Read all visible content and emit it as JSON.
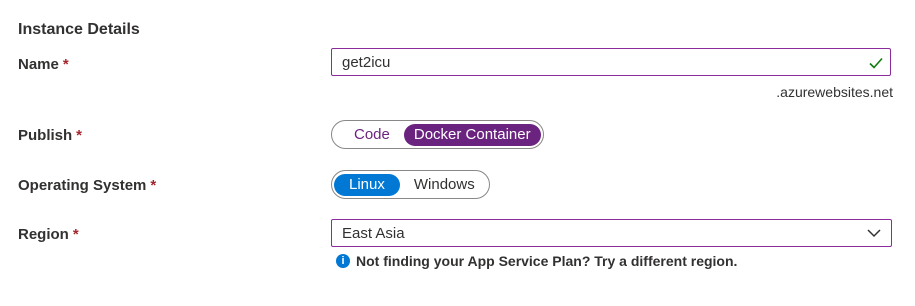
{
  "section": {
    "title": "Instance Details"
  },
  "fields": {
    "name": {
      "label": "Name",
      "required": "*",
      "value": "get2icu",
      "suffix": ".azurewebsites.net"
    },
    "publish": {
      "label": "Publish",
      "required": "*",
      "options": [
        "Code",
        "Docker Container"
      ],
      "selected": "Docker Container"
    },
    "os": {
      "label": "Operating System",
      "required": "*",
      "options": [
        "Linux",
        "Windows"
      ],
      "selected": "Linux"
    },
    "region": {
      "label": "Region",
      "required": "*",
      "value": "East Asia",
      "info": "Not finding your App Service Plan? Try a different region."
    }
  },
  "icons": {
    "valid": "checkmark-icon",
    "dropdown": "chevron-down-icon",
    "info": "info-icon"
  },
  "colors": {
    "accent_purple": "#6b2380",
    "accent_blue": "#0078d4",
    "required_red": "#a4262c",
    "valid_green": "#107c10"
  }
}
